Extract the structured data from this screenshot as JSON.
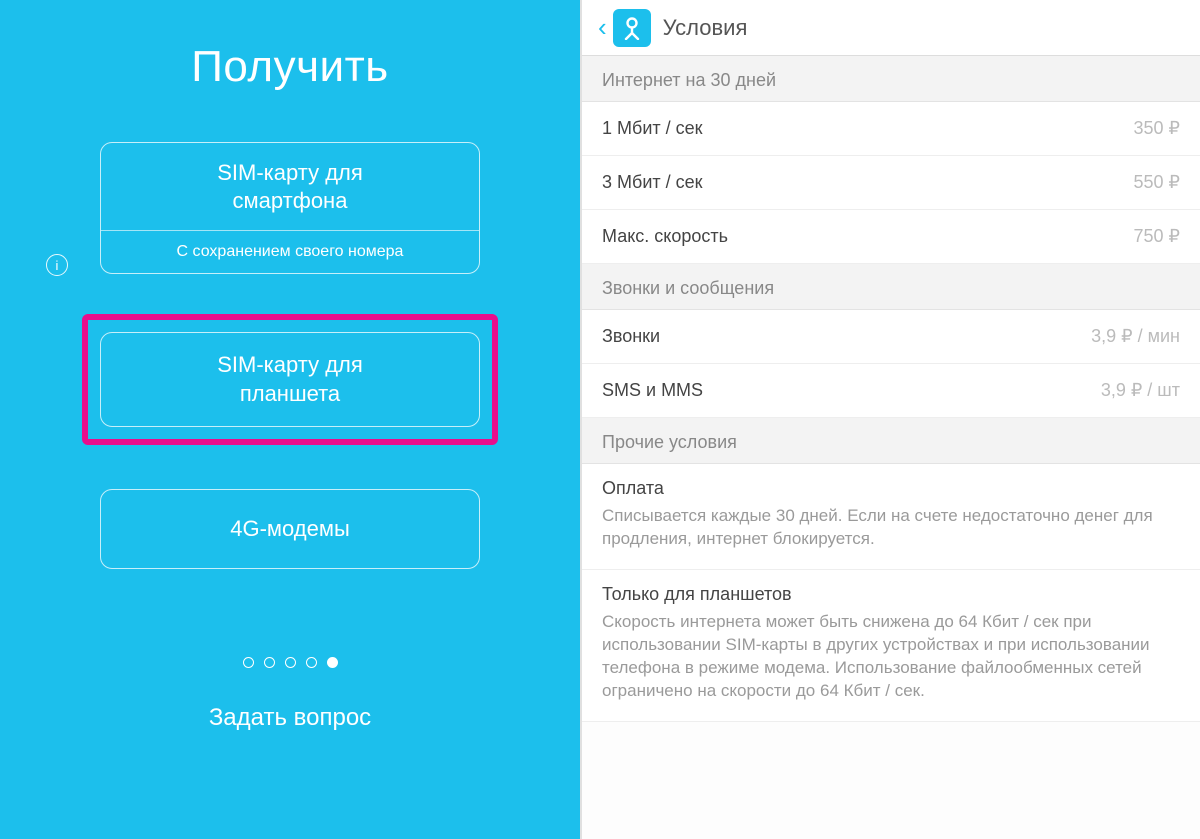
{
  "left": {
    "title": "Получить",
    "info_icon_glyph": "i",
    "sim_phone_line1": "SIM-карту для",
    "sim_phone_line2": "смартфона",
    "sim_phone_sub": "С сохранением своего номера",
    "sim_tablet_line1": "SIM-карту для",
    "sim_tablet_line2": "планшета",
    "modem": "4G-модемы",
    "ask": "Задать вопрос",
    "page_count": 5,
    "active_page": 5
  },
  "right": {
    "header_title": "Условия",
    "sections": {
      "internet": {
        "title": "Интернет на 30 дней",
        "items": [
          {
            "label": "1 Мбит / сек",
            "price": "350 ₽"
          },
          {
            "label": "3 Мбит / сек",
            "price": "550 ₽"
          },
          {
            "label": "Макс. скорость",
            "price": "750 ₽"
          }
        ]
      },
      "calls": {
        "title": "Звонки и сообщения",
        "items": [
          {
            "label": "Звонки",
            "price": "3,9 ₽ / мин"
          },
          {
            "label": "SMS и MMS",
            "price": "3,9 ₽ / шт"
          }
        ]
      },
      "other": {
        "title": "Прочие условия",
        "blocks": [
          {
            "title": "Оплата",
            "body": "Списывается каждые 30 дней. Если на счете недостаточно денег для продления, интернет блокируется."
          },
          {
            "title": "Только для планшетов",
            "body": "Скорость интернета может быть снижена до 64 Кбит / сек при использовании SIM-карты в других устройствах и при использовании телефона в режиме модема. Использование файлообменных сетей ограничено на скорости до 64 Кбит / сек."
          }
        ]
      }
    }
  }
}
